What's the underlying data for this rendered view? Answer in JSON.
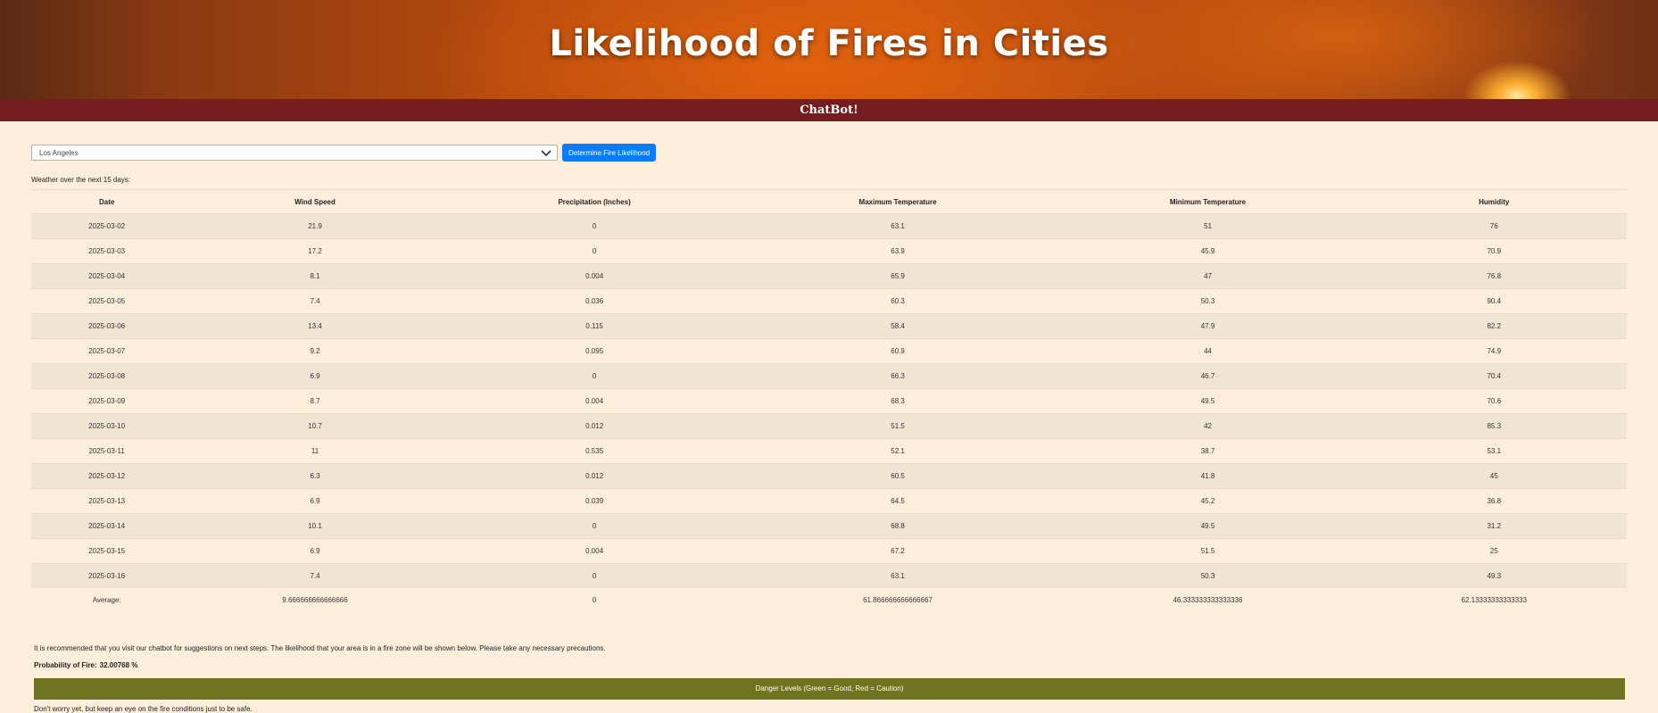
{
  "header": {
    "title": "Likelihood of Fires in Cities"
  },
  "chatbar": {
    "label": "ChatBot!"
  },
  "controls": {
    "city_selected": "Los Angeles",
    "button_label": "Determine Fire Likelihood"
  },
  "weather_label": "Weather over the next 15 days:",
  "table": {
    "headers": [
      "Date",
      "Wind Speed",
      "Precipitation (Inches)",
      "Maximum Temperature",
      "Minimum Temperature",
      "Humidity"
    ],
    "rows": [
      [
        "2025-03-02",
        "21.9",
        "0",
        "63.1",
        "51",
        "76"
      ],
      [
        "2025-03-03",
        "17.2",
        "0",
        "63.9",
        "45.9",
        "70.9"
      ],
      [
        "2025-03-04",
        "8.1",
        "0.004",
        "65.9",
        "47",
        "76.8"
      ],
      [
        "2025-03-05",
        "7.4",
        "0.036",
        "60.3",
        "50.3",
        "90.4"
      ],
      [
        "2025-03-06",
        "13.4",
        "0.115",
        "58.4",
        "47.9",
        "82.2"
      ],
      [
        "2025-03-07",
        "9.2",
        "0.095",
        "60.9",
        "44",
        "74.9"
      ],
      [
        "2025-03-08",
        "6.9",
        "0",
        "66.3",
        "46.7",
        "70.4"
      ],
      [
        "2025-03-09",
        "8.7",
        "0.004",
        "68.3",
        "49.5",
        "70.6"
      ],
      [
        "2025-03-10",
        "10.7",
        "0.012",
        "51.5",
        "42",
        "85.3"
      ],
      [
        "2025-03-11",
        "11",
        "0.535",
        "52.1",
        "38.7",
        "53.1"
      ],
      [
        "2025-03-12",
        "6.3",
        "0.012",
        "60.5",
        "41.8",
        "45"
      ],
      [
        "2025-03-13",
        "6.9",
        "0.039",
        "64.5",
        "45.2",
        "36.8"
      ],
      [
        "2025-03-14",
        "10.1",
        "0",
        "68.8",
        "49.5",
        "31.2"
      ],
      [
        "2025-03-15",
        "6.9",
        "0.004",
        "67.2",
        "51.5",
        "25"
      ],
      [
        "2025-03-16",
        "7.4",
        "0",
        "63.1",
        "50.3",
        "49.3"
      ]
    ],
    "average": [
      "Average:",
      "9.666666666666666",
      "0",
      "61.866666666666667",
      "46.333333333333336",
      "62.13333333333333"
    ]
  },
  "recommendation": "It is recommended that you visit our chatbot for suggestions on next steps. The likelihood that your area is in a fire zone will be shown below. Please take any necessary precautions.",
  "probability": {
    "label": "Probability of Fire:",
    "value": "32.00768 %"
  },
  "danger": {
    "label": "Danger Levels (Green = Good, Red = Caution)",
    "color": "#6f7420"
  },
  "closing": "Don't worry yet, but keep an eye on the fire conditions just to be safe."
}
